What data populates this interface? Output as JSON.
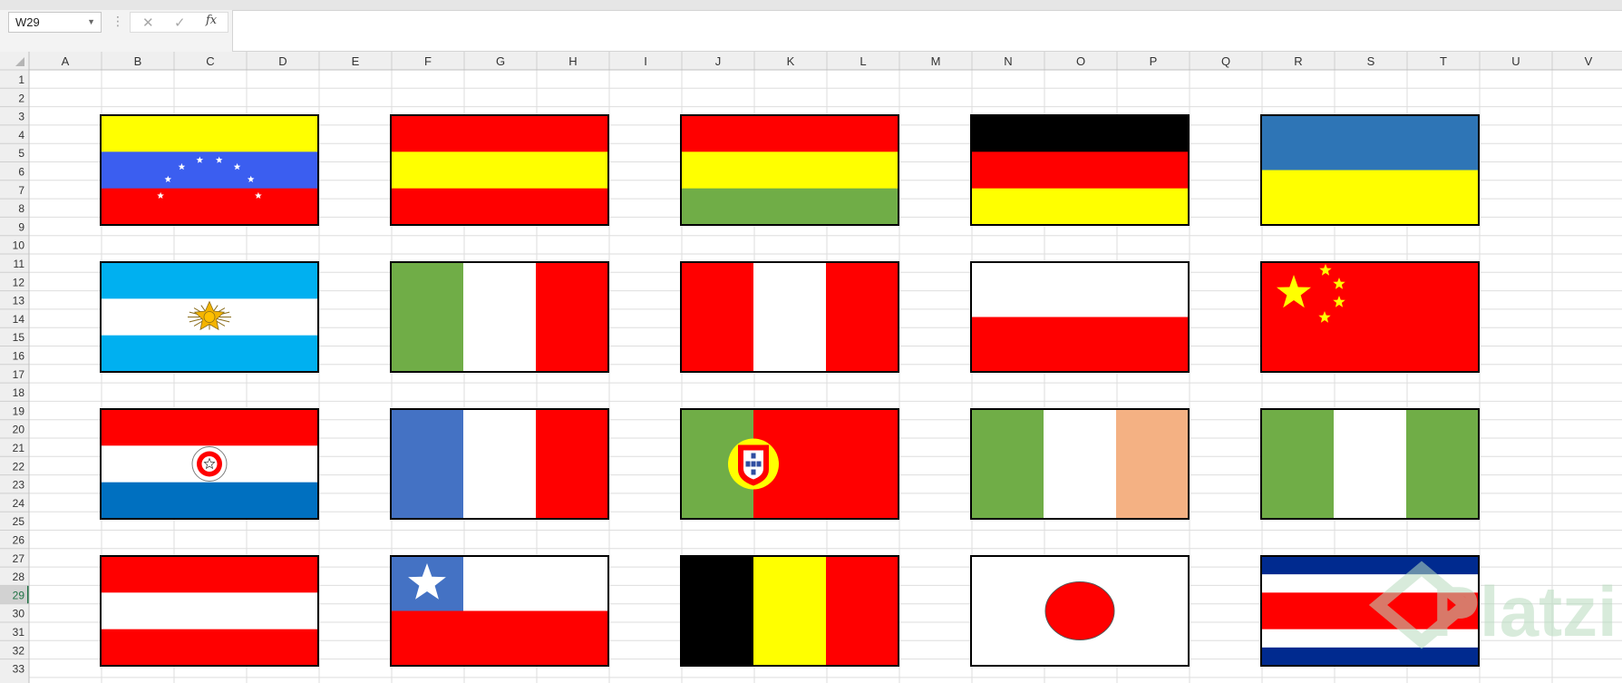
{
  "formula_bar": {
    "name_box": "W29",
    "cancel_icon": "✕",
    "enter_icon": "✓",
    "function_label": "fx",
    "formula_value": ""
  },
  "grid": {
    "columns": [
      "A",
      "B",
      "C",
      "D",
      "E",
      "F",
      "G",
      "H",
      "I",
      "J",
      "K",
      "L",
      "M",
      "N",
      "O",
      "P",
      "Q",
      "R",
      "S",
      "T",
      "U",
      "V"
    ],
    "rows": [
      "1",
      "2",
      "3",
      "4",
      "5",
      "6",
      "7",
      "8",
      "9",
      "10",
      "11",
      "12",
      "13",
      "14",
      "15",
      "16",
      "17",
      "18",
      "19",
      "20",
      "21",
      "22",
      "23",
      "24",
      "25",
      "26",
      "27",
      "28",
      "29",
      "30",
      "31",
      "32",
      "33"
    ],
    "active_row": "29",
    "colors": {
      "header_bg": "#efefef",
      "header_text": "#333333",
      "gridline": "#dedede",
      "active_header": "#d2d2d2"
    }
  },
  "flags": [
    {
      "name": "venezuela",
      "row": 0,
      "col": 0,
      "layout": "h",
      "stripes": [
        "#ffff00",
        "#3b5ef0",
        "#ff0000"
      ],
      "emblem": "stars-arc"
    },
    {
      "name": "spain",
      "row": 0,
      "col": 1,
      "layout": "h",
      "stripes": [
        "#ff0000",
        "#ffff00",
        "#ff0000"
      ]
    },
    {
      "name": "bolivia",
      "row": 0,
      "col": 2,
      "layout": "h",
      "stripes": [
        "#ff0000",
        "#ffff00",
        "#70ad47"
      ]
    },
    {
      "name": "germany",
      "row": 0,
      "col": 3,
      "layout": "h",
      "stripes": [
        "#000000",
        "#ff0000",
        "#ffff00"
      ]
    },
    {
      "name": "ukraine",
      "row": 0,
      "col": 4,
      "layout": "h",
      "stripes": [
        "#2e75b6",
        "#ffff00"
      ]
    },
    {
      "name": "argentina",
      "row": 1,
      "col": 0,
      "layout": "h",
      "stripes": [
        "#00b0f0",
        "#ffffff",
        "#00b0f0"
      ],
      "emblem": "sun"
    },
    {
      "name": "italy",
      "row": 1,
      "col": 1,
      "layout": "v",
      "stripes": [
        "#70ad47",
        "#ffffff",
        "#ff0000"
      ]
    },
    {
      "name": "peru",
      "row": 1,
      "col": 2,
      "layout": "v",
      "stripes": [
        "#ff0000",
        "#ffffff",
        "#ff0000"
      ]
    },
    {
      "name": "poland",
      "row": 1,
      "col": 3,
      "layout": "h",
      "stripes": [
        "#ffffff",
        "#ff0000"
      ]
    },
    {
      "name": "china",
      "row": 1,
      "col": 4,
      "layout": "h",
      "stripes": [
        "#ff0000"
      ],
      "emblem": "china-stars"
    },
    {
      "name": "paraguay",
      "row": 2,
      "col": 0,
      "layout": "h",
      "stripes": [
        "#ff0000",
        "#ffffff",
        "#0070c0"
      ],
      "emblem": "seal"
    },
    {
      "name": "france",
      "row": 2,
      "col": 1,
      "layout": "v",
      "stripes": [
        "#4472c4",
        "#ffffff",
        "#ff0000"
      ]
    },
    {
      "name": "portugal",
      "row": 2,
      "col": 2,
      "layout": "portugal",
      "stripes": [
        "#70ad47",
        "#ff0000"
      ],
      "emblem": "shield"
    },
    {
      "name": "ireland",
      "row": 2,
      "col": 3,
      "layout": "v",
      "stripes": [
        "#70ad47",
        "#ffffff",
        "#f4b183"
      ]
    },
    {
      "name": "nigeria",
      "row": 2,
      "col": 4,
      "layout": "v",
      "stripes": [
        "#70ad47",
        "#ffffff",
        "#70ad47"
      ]
    },
    {
      "name": "austria",
      "row": 3,
      "col": 0,
      "layout": "h",
      "stripes": [
        "#ff0000",
        "#ffffff",
        "#ff0000"
      ]
    },
    {
      "name": "chile",
      "row": 3,
      "col": 1,
      "layout": "chile",
      "stripes": [
        "#4472c4",
        "#ffffff",
        "#ff0000"
      ],
      "emblem": "star"
    },
    {
      "name": "belgium",
      "row": 3,
      "col": 2,
      "layout": "v",
      "stripes": [
        "#000000",
        "#ffff00",
        "#ff0000"
      ]
    },
    {
      "name": "japan",
      "row": 3,
      "col": 3,
      "layout": "h",
      "stripes": [
        "#ffffff"
      ],
      "emblem": "disc"
    },
    {
      "name": "costa-rica",
      "row": 3,
      "col": 4,
      "layout": "costarica",
      "stripes": [
        "#002a8f",
        "#ffffff",
        "#ff0000",
        "#ffffff",
        "#002a8f"
      ]
    }
  ],
  "watermark": {
    "text": "Platzi",
    "color": "#b9dcbf"
  }
}
